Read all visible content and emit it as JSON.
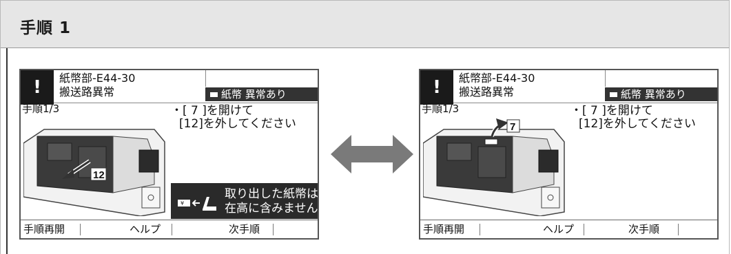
{
  "header": {
    "title": "手順 1"
  },
  "screens": [
    {
      "error_code": "紙幣部-E44-30",
      "error_title": "搬送路異常",
      "alert_glyph": "!",
      "status_badge": "紙幣 異常あり",
      "step_counter": "手順1/3",
      "instruction_line1": "・[ 7 ]を開けて",
      "instruction_line2": "[12]を外してください",
      "callout_label": "12",
      "notice_line1": "取り出した紙幣は",
      "notice_line2": "在高に含みません",
      "notice_icon": "yen-note-hand-icon",
      "softkeys": [
        "手順再開",
        "ヘルプ",
        "次手順"
      ]
    },
    {
      "error_code": "紙幣部-E44-30",
      "error_title": "搬送路異常",
      "alert_glyph": "!",
      "status_badge": "紙幣 異常あり",
      "step_counter": "手順1/3",
      "instruction_line1": "・[ 7 ]を開けて",
      "instruction_line2": "[12]を外してください",
      "callout_label": "7",
      "softkeys": [
        "手順再開",
        "ヘルプ",
        "次手順"
      ]
    }
  ],
  "swap_icon": "double-arrow-icon",
  "colors": {
    "header_bg": "#e6e6e6",
    "dark": "#2a2a2a",
    "swap_arrow": "#7a7a7a"
  }
}
